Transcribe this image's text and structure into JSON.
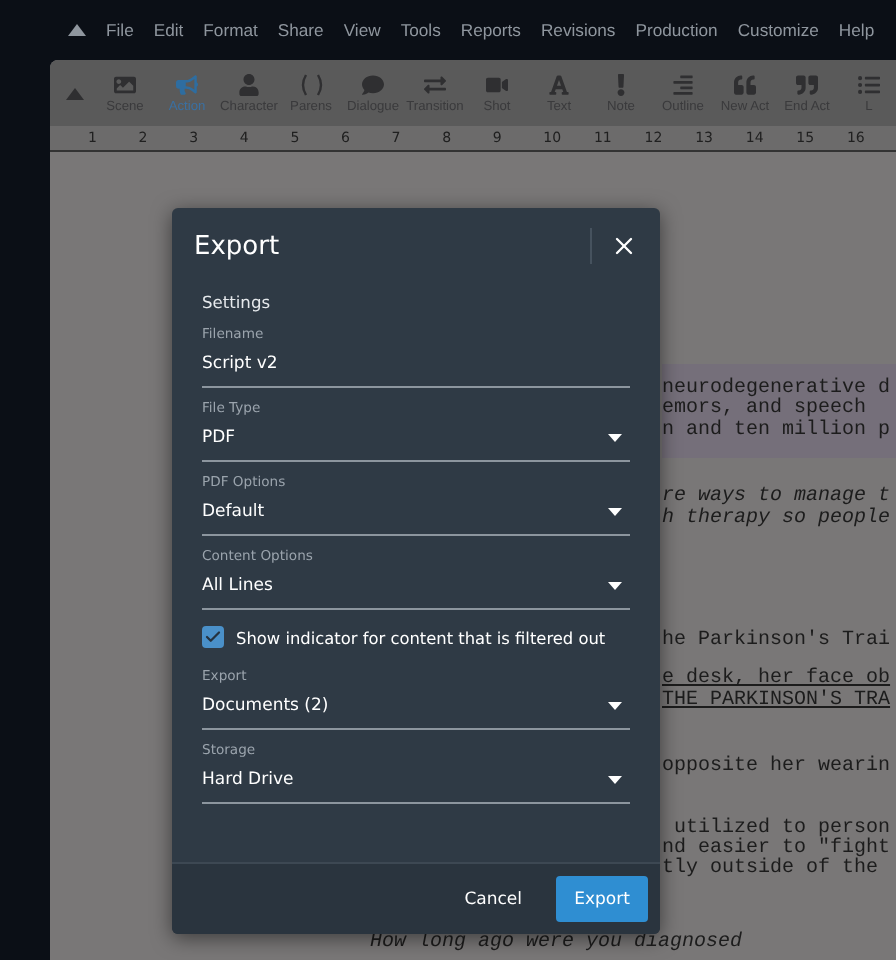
{
  "menu": [
    "File",
    "Edit",
    "Format",
    "Share",
    "View",
    "Tools",
    "Reports",
    "Revisions",
    "Production",
    "Customize",
    "Help"
  ],
  "toolbar": [
    {
      "label": "Scene",
      "selected": false
    },
    {
      "label": "Action",
      "selected": true
    },
    {
      "label": "Character",
      "selected": false
    },
    {
      "label": "Parens",
      "selected": false
    },
    {
      "label": "Dialogue",
      "selected": false
    },
    {
      "label": "Transition",
      "selected": false
    },
    {
      "label": "Shot",
      "selected": false
    },
    {
      "label": "Text",
      "selected": false
    },
    {
      "label": "Note",
      "selected": false
    },
    {
      "label": "Outline",
      "selected": false
    },
    {
      "label": "New Act",
      "selected": false
    },
    {
      "label": "End Act",
      "selected": false
    },
    {
      "label": "L",
      "selected": false
    }
  ],
  "ruler": [
    "1",
    "2",
    "3",
    "4",
    "5",
    "6",
    "7",
    "8",
    "9",
    "10",
    "11",
    "12",
    "13",
    "14",
    "15",
    "16"
  ],
  "script_lines": [
    {
      "text": "neurodegenerative d",
      "kind": "highlight"
    },
    {
      "text": "emors, and speech",
      "kind": "highlight"
    },
    {
      "text": "n and ten million p",
      "kind": "highlight"
    },
    {
      "text": "re ways to manage t",
      "kind": "italic"
    },
    {
      "text": "h therapy so people",
      "kind": "italic"
    },
    {
      "text": "he Parkinson's Trai",
      "kind": "plain"
    },
    {
      "text": "e desk, her face ob",
      "kind": "underline"
    },
    {
      "text": "THE PARKINSON'S TRA",
      "kind": "underline"
    },
    {
      "text": "opposite her wearin",
      "kind": "plain"
    },
    {
      "text": " utilized to person",
      "kind": "plain"
    },
    {
      "text": "nd easier to \"fight",
      "kind": "plain"
    },
    {
      "text": "tly outside of the",
      "kind": "plain"
    }
  ],
  "script_bottom": "How long ago were you diagnosed",
  "dialog": {
    "title": "Export",
    "section": "Settings",
    "filename": {
      "label": "Filename",
      "value": "Script v2"
    },
    "selects": [
      {
        "label": "File Type",
        "value": "PDF"
      },
      {
        "label": "PDF Options",
        "value": "Default"
      },
      {
        "label": "Content Options",
        "value": "All Lines"
      }
    ],
    "checkbox": {
      "label": "Show indicator for content that is filtered out",
      "checked": true
    },
    "selects2": [
      {
        "label": "Export",
        "value": "Documents (2)"
      },
      {
        "label": "Storage",
        "value": "Hard Drive"
      }
    ],
    "buttons": {
      "cancel": "Cancel",
      "confirm": "Export"
    }
  }
}
